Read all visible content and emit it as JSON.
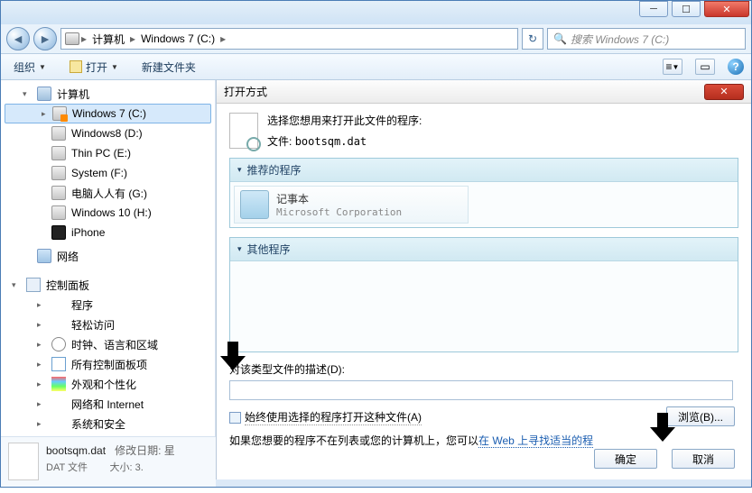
{
  "titlebar": {},
  "nav": {
    "back": "◄",
    "fwd": "►",
    "items": [
      "计算机",
      "Windows 7  (C:)"
    ],
    "search_placeholder": "搜索 Windows 7  (C:)"
  },
  "toolbar": {
    "organize": "组织",
    "open": "打开",
    "newfolder": "新建文件夹"
  },
  "tree": {
    "computer": "计算机",
    "drives": [
      {
        "label": "Windows 7  (C:)",
        "selected": true,
        "win": true
      },
      {
        "label": "Windows8 (D:)"
      },
      {
        "label": "Thin PC (E:)"
      },
      {
        "label": "System (F:)"
      },
      {
        "label": "电脑人人有  (G:)"
      },
      {
        "label": "Windows 10 (H:)"
      },
      {
        "label": "iPhone",
        "phone": true
      }
    ],
    "network": "网络",
    "cpanel": "控制面板",
    "cpitems": [
      {
        "label": "程序",
        "ico": "ico-prog",
        "exp": true
      },
      {
        "label": "轻松访问",
        "ico": "ico-ease",
        "exp": true
      },
      {
        "label": "时钟、语言和区域",
        "ico": "ico-clock",
        "exp": true
      },
      {
        "label": "所有控制面板项",
        "ico": "ico-ctrl",
        "exp": true
      },
      {
        "label": "外观和个性化",
        "ico": "ico-pers",
        "exp": true
      },
      {
        "label": "网络和 Internet",
        "ico": "ico-neti",
        "exp": true
      },
      {
        "label": "系统和安全",
        "ico": "ico-sys",
        "exp": true
      }
    ]
  },
  "status": {
    "filename": "bootsqm.dat",
    "mod_label": "修改日期: 星",
    "type": "DAT 文件",
    "size_label": "大小: 3."
  },
  "dialog": {
    "title": "打开方式",
    "prompt": "选择您想用来打开此文件的程序:",
    "file_label": "文件:",
    "file_name": "bootsqm.dat",
    "recommended": "推荐的程序",
    "app_name": "记事本",
    "app_vendor": "Microsoft Corporation",
    "other": "其他程序",
    "desc_label": "对该类型文件的描述(D):",
    "always_use": "始终使用选择的程序打开这种文件(A)",
    "hint_prefix": "如果您想要的程序不在列表或您的计算机上，您可以",
    "hint_link": "在 Web 上寻找适当的程",
    "browse": "浏览(B)...",
    "ok": "确定",
    "cancel": "取消"
  }
}
